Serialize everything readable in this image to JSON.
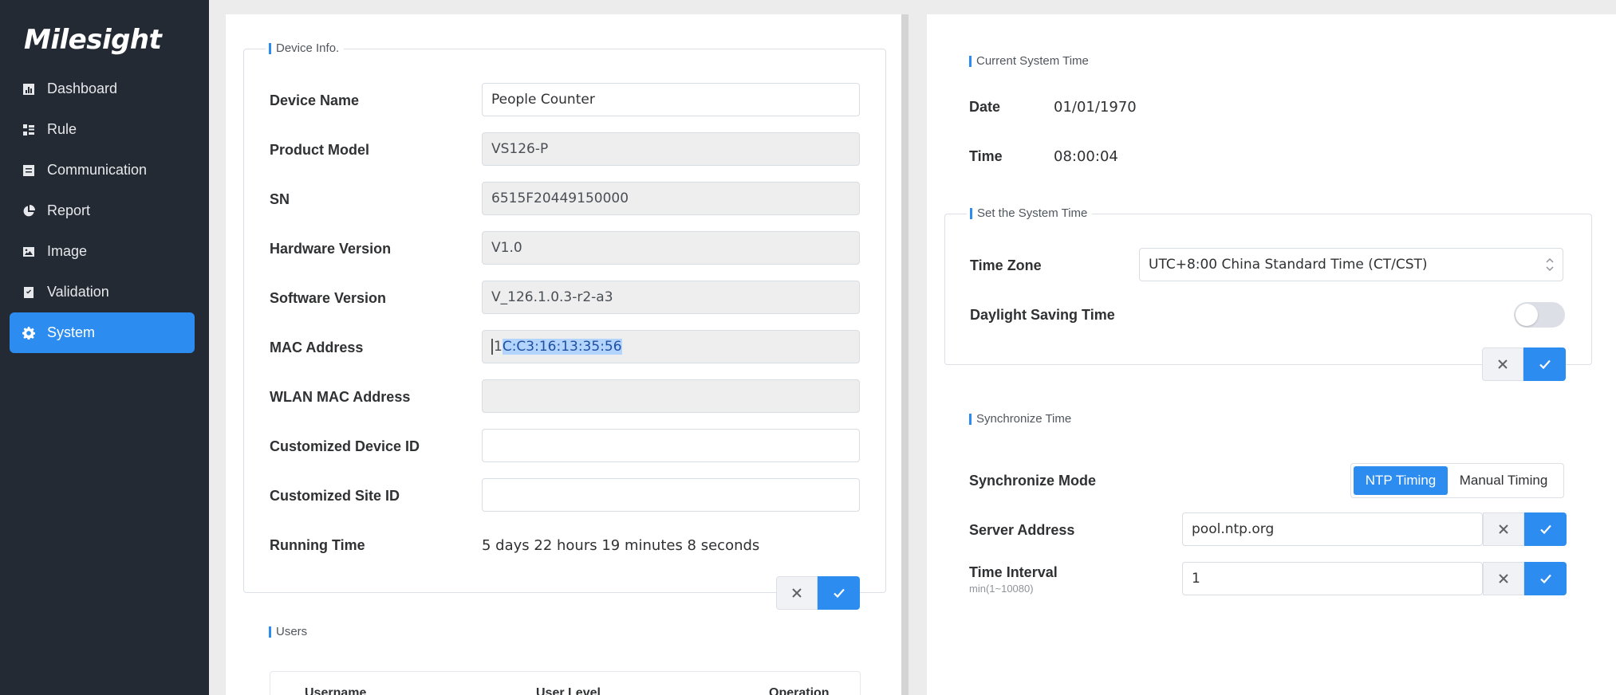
{
  "app": {
    "logo": "Milesight"
  },
  "sidebar": {
    "items": [
      {
        "label": "Dashboard",
        "icon": "dashboard-icon"
      },
      {
        "label": "Rule",
        "icon": "rule-icon"
      },
      {
        "label": "Communication",
        "icon": "communication-icon"
      },
      {
        "label": "Report",
        "icon": "report-icon"
      },
      {
        "label": "Image",
        "icon": "image-icon"
      },
      {
        "label": "Validation",
        "icon": "validation-icon"
      },
      {
        "label": "System",
        "icon": "gear-icon",
        "active": true
      }
    ]
  },
  "device_info": {
    "title": "Device Info.",
    "fields": [
      {
        "label": "Device Name",
        "value": "People Counter"
      },
      {
        "label": "Product Model",
        "value": "VS126-P"
      },
      {
        "label": "SN",
        "value": "6515F20449150000"
      },
      {
        "label": "Hardware Version",
        "value": "V1.0"
      },
      {
        "label": "Software Version",
        "value": "V_126.1.0.3-r2-a3"
      },
      {
        "label": "MAC Address",
        "value_prefix": "1",
        "value_selected": "C:C3:16:13:35:56"
      },
      {
        "label": "WLAN MAC Address",
        "value": ""
      },
      {
        "label": "Customized Device ID",
        "value": ""
      },
      {
        "label": "Customized Site ID",
        "value": ""
      },
      {
        "label": "Running Time",
        "value": "5 days 22 hours 19 minutes 8 seconds"
      }
    ]
  },
  "users": {
    "title": "Users",
    "columns": [
      "Username",
      "User Level",
      "Operation"
    ]
  },
  "current_time": {
    "title": "Current System Time",
    "date_label": "Date",
    "date_value": "01/01/1970",
    "time_label": "Time",
    "time_value": "08:00:04"
  },
  "set_time": {
    "title": "Set the System Time",
    "timezone_label": "Time Zone",
    "timezone_value": "UTC+8:00 China Standard Time (CT/CST)",
    "dst_label": "Daylight Saving Time",
    "dst_enabled": false
  },
  "sync_time": {
    "title": "Synchronize Time",
    "mode_label": "Synchronize Mode",
    "modes": [
      "NTP Timing",
      "Manual Timing"
    ],
    "selected_mode": "NTP Timing",
    "server_label": "Server Address",
    "server_value": "pool.ntp.org",
    "interval_label": "Time Interval",
    "interval_hint": "min(1~10080)",
    "interval_value": "1"
  },
  "colors": {
    "accent": "#2d8cf0",
    "sidebar_bg": "#232a33"
  }
}
